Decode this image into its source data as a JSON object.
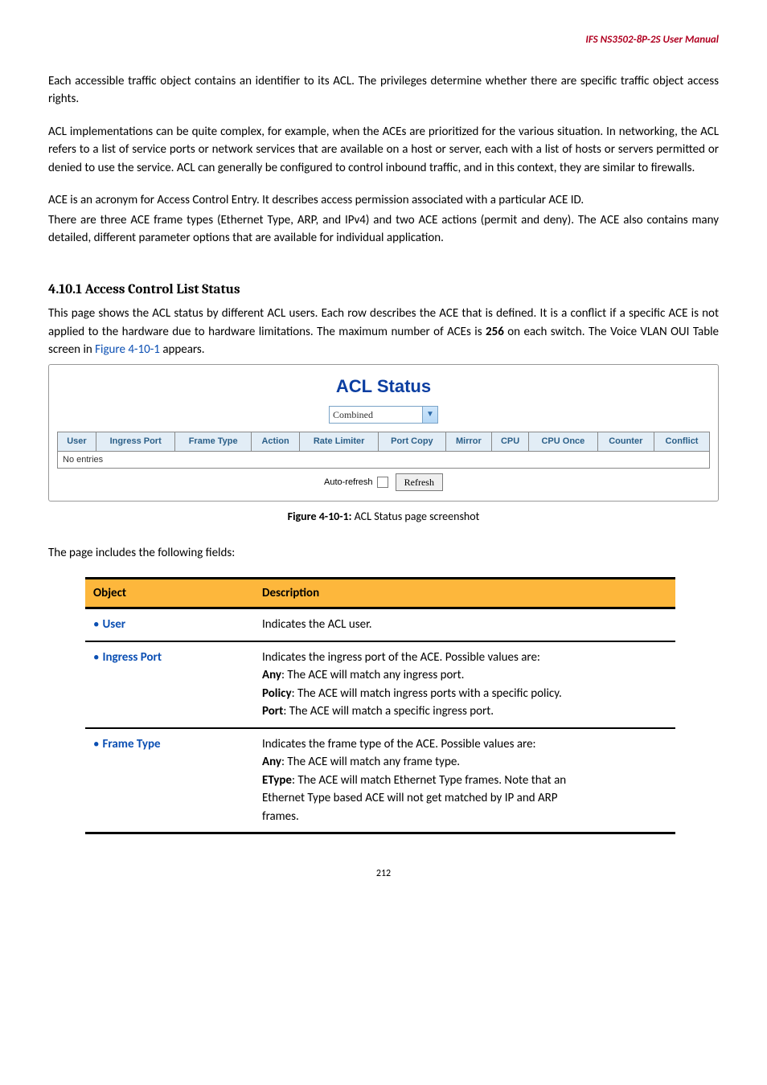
{
  "header": {
    "product": "IFS  NS3502-8P-2S  User  Manual"
  },
  "intro": {
    "p1": "Each accessible traffic object contains an identifier to its ACL. The privileges determine whether there are specific traffic object access rights.",
    "p2": "ACL implementations can be quite complex, for example, when the ACEs are prioritized for the various situation. In networking, the ACL refers to a list of service ports or network services that are available on a host or server, each with a list of hosts or servers permitted or denied to use the service. ACL can generally be configured to control inbound traffic, and in this context, they are similar to firewalls.",
    "p3": "ACE is an acronym for Access Control Entry. It describes access permission associated with a particular ACE ID.",
    "p4": "There are three ACE frame types (Ethernet Type, ARP, and IPv4) and two ACE actions (permit and deny). The ACE also contains many detailed, different parameter options that are available for individual application."
  },
  "section": {
    "heading": "4.10.1 Access Control List Status",
    "desc_pre": "This page shows the ACL status by different ACL users. Each row describes the ACE that is defined. It is a conflict if a specific ACE is not applied to the hardware due to hardware limitations. The maximum number of ACEs is ",
    "desc_bold": "256",
    "desc_mid": " on each switch. The Voice VLAN OUI Table screen in ",
    "desc_link": "Figure 4-10-1",
    "desc_post": " appears."
  },
  "screenshot": {
    "title": "ACL Status",
    "combo_value": "Combined",
    "columns": [
      "User",
      "Ingress Port",
      "Frame Type",
      "Action",
      "Rate Limiter",
      "Port Copy",
      "Mirror",
      "CPU",
      "CPU Once",
      "Counter",
      "Conflict"
    ],
    "empty_row": "No entries",
    "auto_refresh_label": "Auto-refresh",
    "refresh_button": "Refresh"
  },
  "caption": {
    "bold": "Figure 4-10-1:",
    "rest": " ACL Status page screenshot"
  },
  "fields_intro": "The page includes the following fields:",
  "fields_table": {
    "head_object": "Object",
    "head_desc": "Description",
    "rows": [
      {
        "label": "User",
        "lines": [
          "Indicates the ACL user."
        ]
      },
      {
        "label": "Ingress Port",
        "lines": [
          "Indicates the ingress port of the ACE. Possible values are:",
          "<b>Any</b>: The ACE will match any ingress port.",
          "<b>Policy</b>: The ACE will match ingress ports with a specific policy.",
          "<b>Port</b>: The ACE will match a specific ingress port."
        ]
      },
      {
        "label": "Frame Type",
        "lines": [
          "Indicates the frame type of the ACE. Possible values are:",
          "<b>Any</b>: The ACE will match any frame type.",
          "<b>EType</b>: The ACE will match Ethernet Type frames. Note that an",
          "Ethernet Type based ACE will not get matched by IP and ARP",
          "frames."
        ]
      }
    ]
  },
  "page_number": "212"
}
